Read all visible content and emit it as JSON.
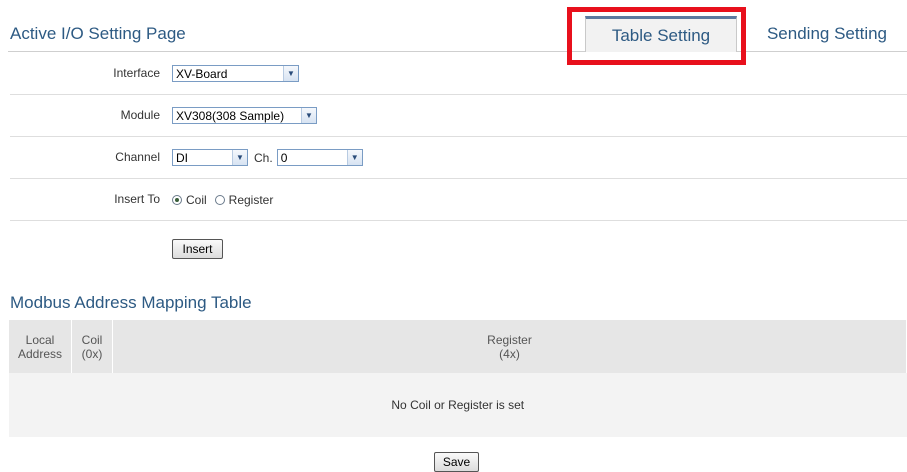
{
  "header": {
    "title": "Active I/O Setting Page",
    "tabs": [
      "Table Setting",
      "Sending Setting"
    ]
  },
  "form": {
    "interface": {
      "label": "Interface",
      "value": "XV-Board"
    },
    "module": {
      "label": "Module",
      "value": "XV308(308 Sample)"
    },
    "channel": {
      "label": "Channel",
      "type_value": "DI",
      "ch_label": "Ch.",
      "ch_value": "0"
    },
    "insert_to": {
      "label": "Insert To",
      "options": [
        "Coil",
        "Register"
      ],
      "selected": "Coil"
    },
    "insert_button": "Insert"
  },
  "mapping": {
    "title": "Modbus Address Mapping Table",
    "columns": [
      {
        "line1": "Local",
        "line2": "Address"
      },
      {
        "line1": "Coil",
        "line2": "(0x)"
      },
      {
        "line1": "Register",
        "line2": "(4x)"
      }
    ],
    "empty_message": "No Coil or Register is set"
  },
  "save_button": "Save",
  "colors": {
    "accent": "#2d5a83",
    "highlight": "#e8101c"
  }
}
